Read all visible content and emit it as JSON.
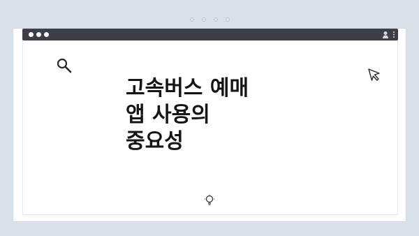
{
  "article": {
    "title": "고속버스 예매\n앱 사용의\n중요성"
  },
  "icons": {
    "search": "search-icon",
    "cursor": "cursor-pointer-icon",
    "idea": "lightbulb-icon",
    "profile": "profile-icon",
    "menu": "kebab-menu-icon"
  },
  "colors": {
    "background": "#d9e1ea",
    "titlebar": "#3c3f46",
    "title_text": "#151515"
  }
}
